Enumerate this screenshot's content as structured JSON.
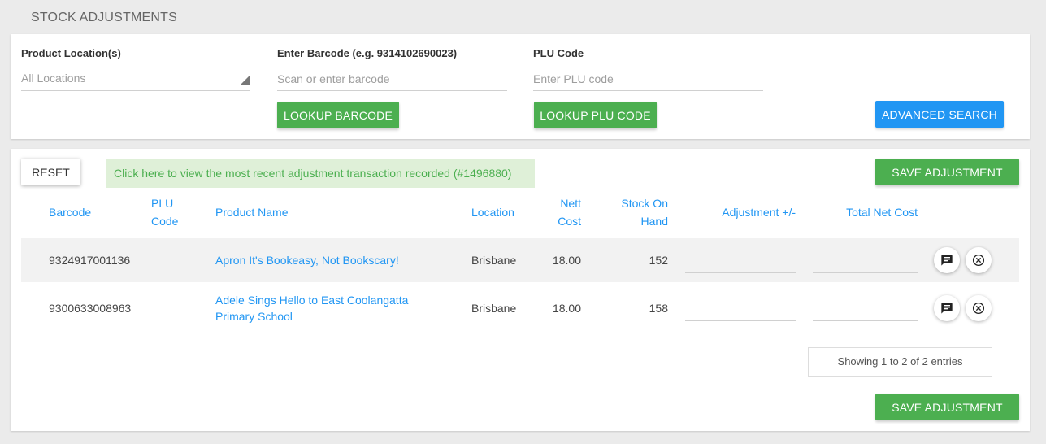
{
  "page": {
    "title": "STOCK ADJUSTMENTS"
  },
  "search": {
    "location_label": "Product Location(s)",
    "location_value": "All Locations",
    "barcode_label": "Enter Barcode (e.g. 9314102690023)",
    "barcode_placeholder": "Scan or enter barcode",
    "plu_label": "PLU Code",
    "plu_placeholder": "Enter PLU code",
    "lookup_barcode_label": "LOOKUP BARCODE",
    "lookup_plu_label": "LOOKUP PLU CODE",
    "advanced_search_label": "ADVANCED SEARCH"
  },
  "toolbar": {
    "reset_label": "RESET",
    "recent_notice": "Click here to view the most recent adjustment transaction recorded (#1496880)",
    "save_label": "SAVE ADJUSTMENT"
  },
  "table": {
    "headers": {
      "barcode": "Barcode",
      "plu_line1": "PLU",
      "plu_line2": "Code",
      "product_name": "Product Name",
      "location": "Location",
      "nett_cost_line1": "Nett",
      "nett_cost_line2": "Cost",
      "stock_line1": "Stock On",
      "stock_line2": "Hand",
      "adjustment": "Adjustment +/-",
      "total_net_cost": "Total Net Cost"
    },
    "rows": [
      {
        "barcode": "9324917001136",
        "plu": "",
        "product_name_line1": "Apron It's Bookeasy, Not Bookscary!",
        "product_name_line2": "",
        "location": "Brisbane",
        "nett_cost": "18.00",
        "stock_on_hand": "152"
      },
      {
        "barcode": "9300633008963",
        "plu": "",
        "product_name_line1": "Adele Sings Hello to East Coolangatta",
        "product_name_line2": "Primary School",
        "location": "Brisbane",
        "nett_cost": "18.00",
        "stock_on_hand": "158"
      }
    ],
    "pager_info": "Showing 1 to 2 of 2 entries"
  },
  "colors": {
    "accent_blue": "#2196f3",
    "button_green": "#4caf50",
    "notice_bg": "#dff0d8"
  },
  "icons": {
    "comment": "comment-icon",
    "remove": "close-circle-icon"
  }
}
